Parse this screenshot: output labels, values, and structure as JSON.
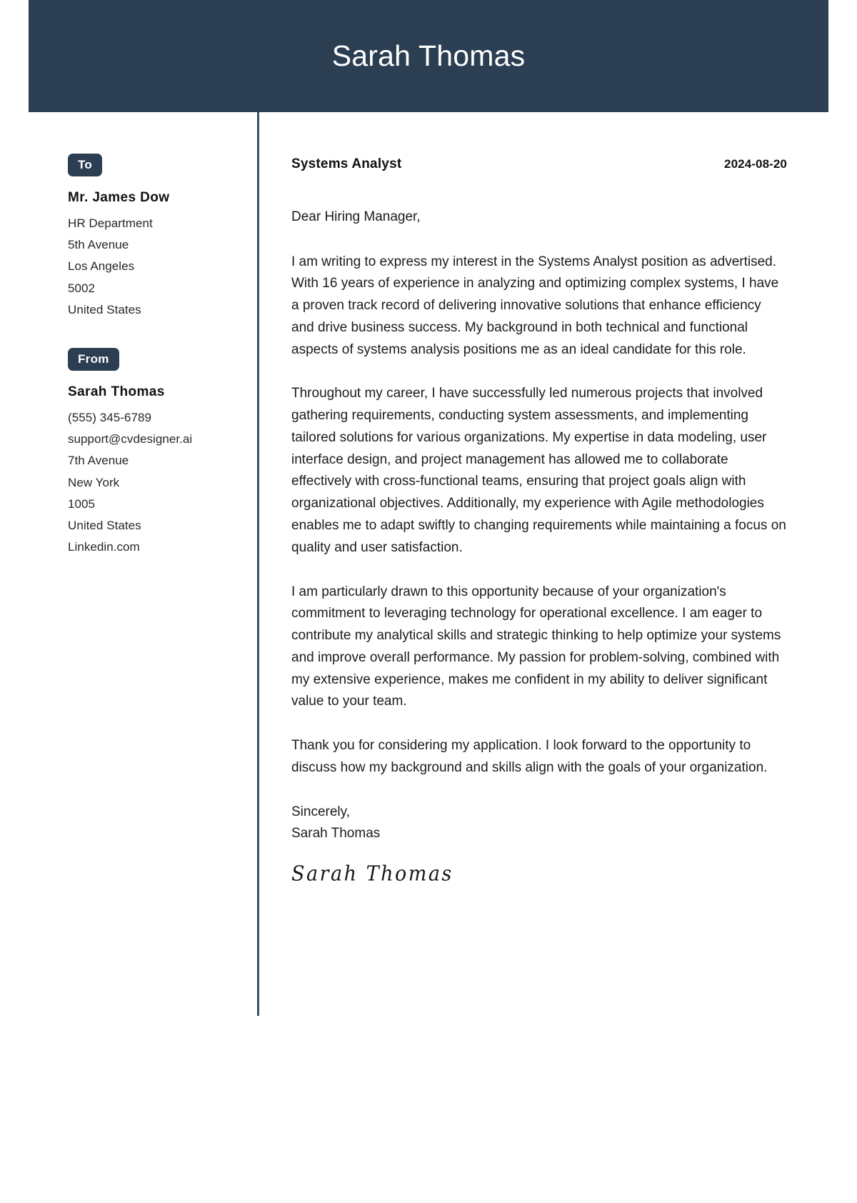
{
  "header": {
    "name": "Sarah Thomas"
  },
  "sidebar": {
    "to_badge": "To",
    "recipient": {
      "name": "Mr. James Dow",
      "lines": [
        "HR Department",
        "5th Avenue",
        "Los Angeles",
        "5002",
        "United States"
      ]
    },
    "from_badge": "From",
    "sender": {
      "name": "Sarah Thomas",
      "lines": [
        "(555) 345-6789",
        "support@cvdesigner.ai",
        "7th Avenue",
        "New York",
        "1005",
        "United States",
        "Linkedin.com"
      ]
    }
  },
  "letter": {
    "job_title": "Systems Analyst",
    "date": "2024-08-20",
    "salutation": "Dear Hiring Manager,",
    "paragraphs": [
      "I am writing to express my interest in the Systems Analyst position as advertised. With 16 years of experience in analyzing and optimizing complex systems, I have a proven track record of delivering innovative solutions that enhance efficiency and drive business success. My background in both technical and functional aspects of systems analysis positions me as an ideal candidate for this role.",
      "Throughout my career, I have successfully led numerous projects that involved gathering requirements, conducting system assessments, and implementing tailored solutions for various organizations. My expertise in data modeling, user interface design, and project management has allowed me to collaborate effectively with cross-functional teams, ensuring that project goals align with organizational objectives. Additionally, my experience with Agile methodologies enables me to adapt swiftly to changing requirements while maintaining a focus on quality and user satisfaction.",
      "I am particularly drawn to this opportunity because of your organization's commitment to leveraging technology for operational excellence. I am eager to contribute my analytical skills and strategic thinking to help optimize your systems and improve overall performance. My passion for problem-solving, combined with my extensive experience, makes me confident in my ability to deliver significant value to your team.",
      "Thank you for considering my application. I look forward to the opportunity to discuss how my background and skills align with the goals of your organization."
    ],
    "closing": "Sincerely,",
    "closing_name": "Sarah Thomas",
    "signature": "Sarah Thomas"
  },
  "colors": {
    "banner": "#2b3e52",
    "divider": "#37506b",
    "badge": "#2b3e52",
    "text": "#1b1b1b"
  }
}
